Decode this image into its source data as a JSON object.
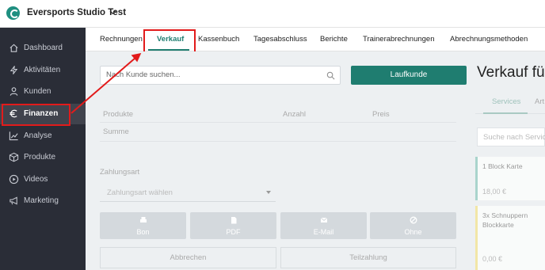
{
  "header": {
    "studio_name": "Eversports Studio Test"
  },
  "sidebar": {
    "items": [
      {
        "label": "Dashboard",
        "icon": "home-icon"
      },
      {
        "label": "Aktivitäten",
        "icon": "activity-icon"
      },
      {
        "label": "Kunden",
        "icon": "user-icon"
      },
      {
        "label": "Finanzen",
        "icon": "euro-icon"
      },
      {
        "label": "Analyse",
        "icon": "chart-line-icon"
      },
      {
        "label": "Produkte",
        "icon": "box-icon"
      },
      {
        "label": "Videos",
        "icon": "play-icon"
      },
      {
        "label": "Marketing",
        "icon": "megaphone-icon"
      }
    ],
    "active": "Finanzen"
  },
  "tabs": [
    "Rechnungen",
    "Verkauf",
    "Kassenbuch",
    "Tagesabschluss",
    "Berichte",
    "Trainerabrechnungen",
    "Abrechnungsmethoden"
  ],
  "active_tab": "Verkauf",
  "main": {
    "search_placeholder": "Nach Kunde suchen...",
    "laufkunde_label": "Laufkunde",
    "title": "Verkauf für",
    "columns": {
      "produkte": "Produkte",
      "anzahl": "Anzahl",
      "preis": "Preis"
    },
    "summe_label": "Summe",
    "zahlungsart_label": "Zahlungsart",
    "zahlungsart_placeholder": "Zahlungsart wählen",
    "payment_buttons": [
      {
        "label": "Bon",
        "icon": "printer-icon"
      },
      {
        "label": "PDF",
        "icon": "document-icon"
      },
      {
        "label": "E-Mail",
        "icon": "mail-icon"
      },
      {
        "label": "Ohne",
        "icon": "ban-icon"
      }
    ],
    "abbrechen_label": "Abbrechen",
    "teilzahlung_label": "Teilzahlung"
  },
  "right_panel": {
    "tabs": [
      "Services",
      "Art"
    ],
    "search_placeholder": "Suche nach Service",
    "cards": [
      {
        "title": "1 Block Karte",
        "price": "18,00 €",
        "color": "#a9d4cc"
      },
      {
        "title": "3x Schnuppern Blockkarte",
        "price": "0,00 €",
        "color": "#f2e6a6"
      }
    ]
  },
  "colors": {
    "accent": "#1f7d70",
    "sidebar": "#2a2d37",
    "highlight": "#e21b1b"
  }
}
